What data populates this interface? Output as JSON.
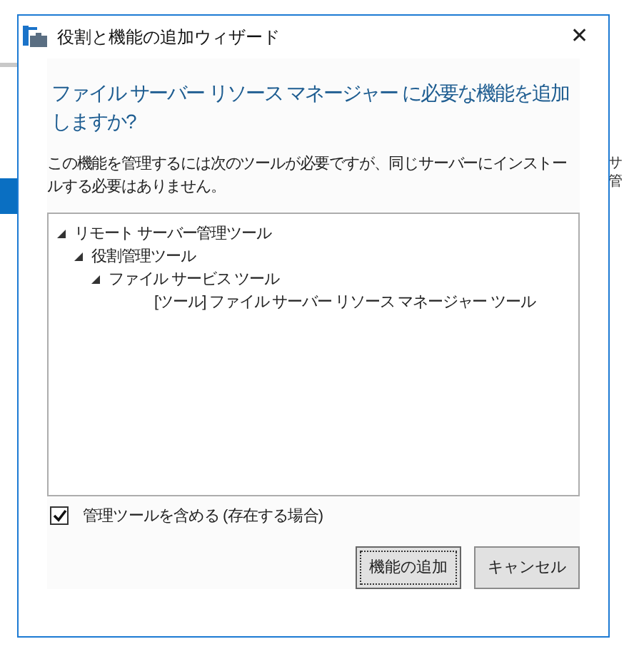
{
  "background": {
    "side_text": [
      "サ",
      "管"
    ]
  },
  "window": {
    "title": "役割と機能の追加ウィザード",
    "close": "✕"
  },
  "heading": "ファイル サーバー リソース マネージャー に必要な機能を追加しますか?",
  "description": "この機能を管理するには次のツールが必要ですが、同じサーバーにインストールする必要はありません。",
  "tree": [
    {
      "label": "リモート サーバー管理ツール",
      "expanded": true,
      "children": [
        {
          "label": "役割管理ツール",
          "expanded": true,
          "children": [
            {
              "label": "ファイル サービス ツール",
              "expanded": true,
              "children": [
                {
                  "label": "[ツール] ファイル サーバー リソース マネージャー ツール"
                }
              ]
            }
          ]
        }
      ]
    }
  ],
  "include_tools": {
    "label": "管理ツールを含める (存在する場合)",
    "checked": true
  },
  "buttons": [
    {
      "label": "機能の追加",
      "selected": true
    },
    {
      "label": "キャンセル",
      "selected": false
    }
  ]
}
